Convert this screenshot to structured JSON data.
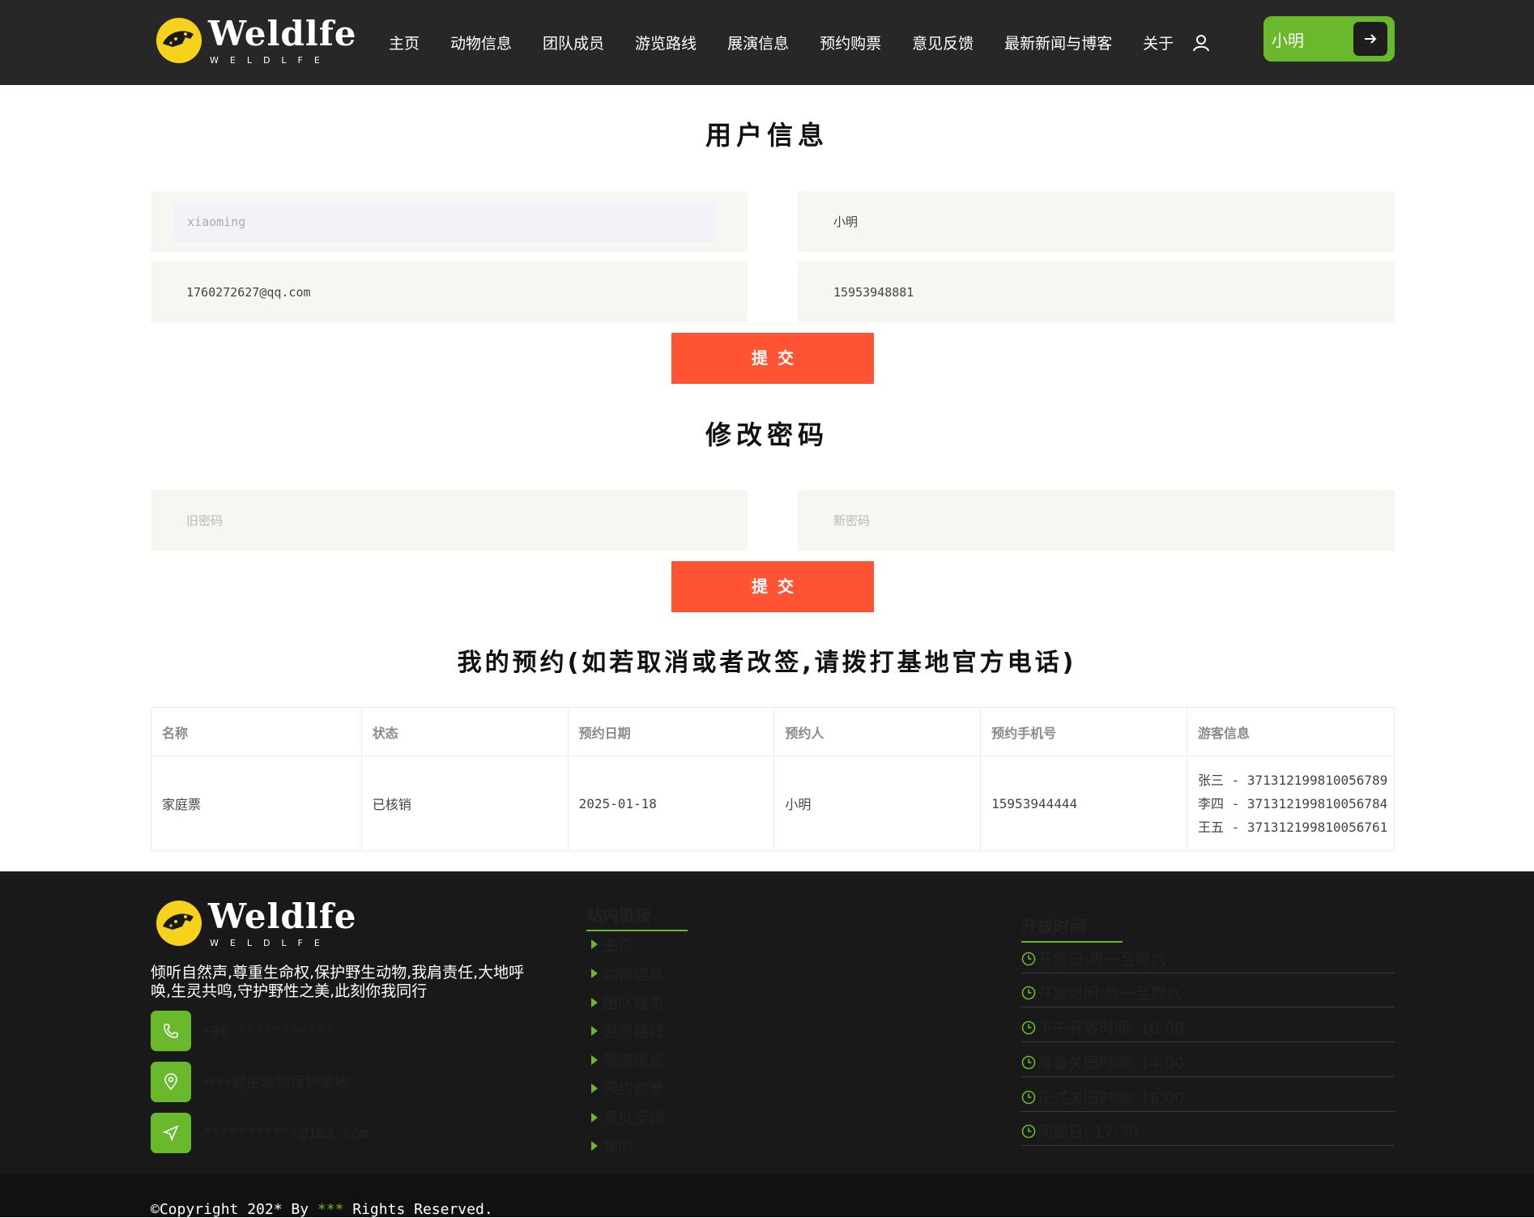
{
  "brand": {
    "title": "Weldlfe",
    "subtitle": "WELDLFE"
  },
  "nav": {
    "items": [
      "主页",
      "动物信息",
      "团队成员",
      "游览路线",
      "展演信息",
      "预约购票",
      "意见反馈",
      "最新新闻与博客",
      "关于"
    ],
    "user_label": "小明"
  },
  "user_info": {
    "title": "用户信息",
    "username": "xiaoming",
    "nickname": "小明",
    "email": "1760272627@qq.com",
    "phone": "15953948881",
    "submit_label": "提交"
  },
  "password": {
    "title": "修改密码",
    "old_placeholder": "旧密码",
    "new_placeholder": "新密码",
    "submit_label": "提交"
  },
  "reservations": {
    "title": "我的预约(如若取消或者改签,请拨打基地官方电话)",
    "headers": [
      "名称",
      "状态",
      "预约日期",
      "预约人",
      "预约手机号",
      "游客信息"
    ],
    "rows": [
      {
        "name": "家庭票",
        "status": "已核销",
        "date": "2025-01-18",
        "person": "小明",
        "phone": "15953944444",
        "visitors": [
          "张三 - 371312199810056789",
          "李四 - 371312199810056784",
          "王五 - 371312199810056761"
        ]
      }
    ]
  },
  "footer": {
    "description": "倾听自然声,尊重生命权,保护野生动物,我肩责任,大地呼唤,生灵共鸣,守护野性之美,此刻你我同行",
    "contacts": [
      {
        "icon": "phone-icon",
        "text": "+86 ***********"
      },
      {
        "icon": "location-icon",
        "text": "****野生动物保护基地"
      },
      {
        "icon": "send-icon",
        "text": "***********@163.com"
      }
    ],
    "links_title": "站内链接",
    "links": [
      "主页",
      "动物信息",
      "团队成员",
      "游览路线",
      "展演信息",
      "预约购票",
      "意见反馈",
      "我的"
    ],
    "hours_title": "开放时间",
    "hours": [
      "开放日:周一至周六",
      "开放时间:周一至周六",
      "下午开放时间: 10:00",
      "准备关园时间: 14:00",
      "正式关园时间: 16:00",
      "闭园日: 17:30"
    ],
    "copyright_prefix": "©Copyright 202* By ",
    "copyright_accent": "***",
    "copyright_suffix": " Rights Reserved."
  },
  "colors": {
    "accent_green": "#6ab82b",
    "submit_orange": "#fe5434",
    "header_bg": "#272727",
    "footer_bg": "#191919"
  }
}
